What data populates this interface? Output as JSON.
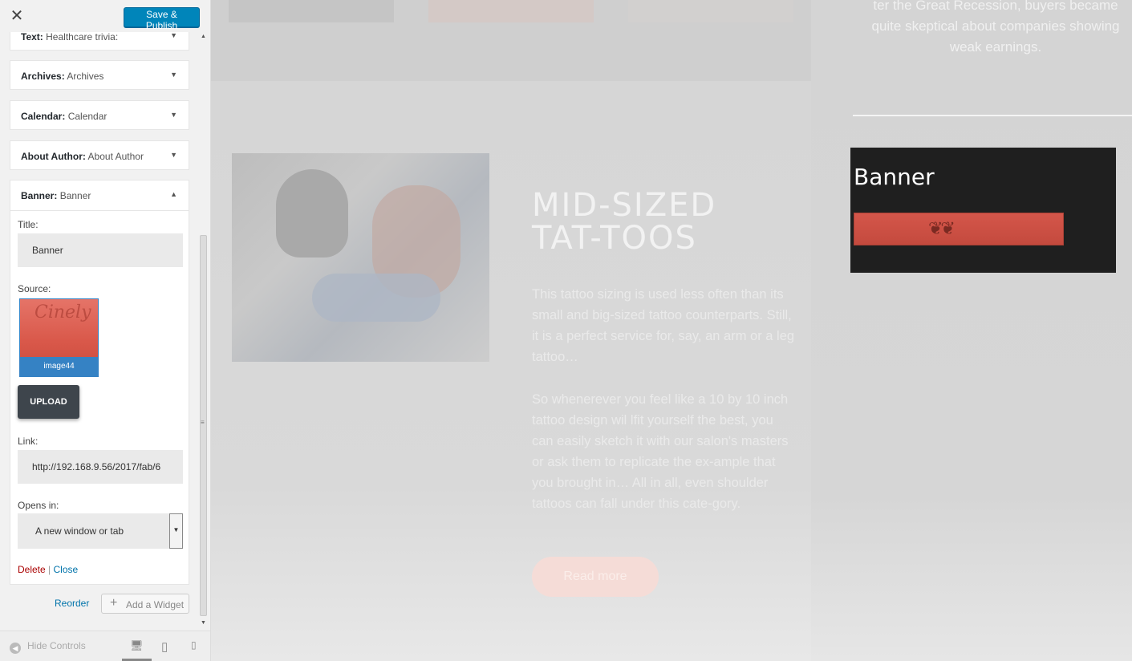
{
  "topbar": {
    "close_glyph": "✕",
    "save_label": "Save & Publish"
  },
  "widgets": [
    {
      "type": "Text",
      "name": "Healthcare trivia:",
      "caret": "▼"
    },
    {
      "type": "Archives",
      "name": "Archives",
      "caret": "▼"
    },
    {
      "type": "Calendar",
      "name": "Calendar",
      "caret": "▼"
    },
    {
      "type": "About Author",
      "name": "About Author",
      "caret": "▼"
    }
  ],
  "banner_widget": {
    "type": "Banner",
    "name": "Banner",
    "caret": "▲",
    "title_label": "Title:",
    "title_value": "Banner",
    "source_label": "Source:",
    "thumb_caption": "image44",
    "upload_label": "UPLOAD",
    "link_label": "Link:",
    "link_value": "http://192.168.9.56/2017/fab/6",
    "opens_label": "Opens in:",
    "opens_value": "A new window or tab",
    "delete_label": "Delete",
    "separator": "|",
    "close_label": "Close"
  },
  "actions": {
    "reorder_label": "Reorder",
    "add_widget_label": "Add a Widget",
    "add_widget_glyph": "+"
  },
  "footer": {
    "hide_controls_label": "Hide Controls",
    "hide_controls_glyph": "◀",
    "device_desktop_glyph": "🖥",
    "device_tablet_glyph": "▯",
    "device_mobile_glyph": "▯"
  },
  "scrollbar": {
    "up": "▲",
    "down": "▼",
    "grip": "≡"
  },
  "preview": {
    "article_title": "MID-SIZED TAT-TOOS",
    "paragraph1": "This tattoo sizing is used less often than its small and big-sized tattoo counterparts. Still, it is a perfect service for, say, an arm or a leg tattoo…",
    "paragraph2": "So whenerever you feel like a 10 by 10 inch tattoo design wil lfit yourself the best, you can easily sketch it with our salon's masters or ask them to replicate the ex-ample that you brought in… All in all, even shoulder tattoos can fall under this cate-gory.",
    "read_more": "Read more",
    "sidebar_text": "ter the Great Recession, buyers became quite skeptical about companies showing weak earnings.",
    "banner_title": "Banner",
    "banner_ornament": "❦❦"
  },
  "colors": {
    "primary_button": "#0085ba",
    "link": "#0073aa",
    "delete": "#aa0000",
    "banner_bg": "#1f1f1f",
    "banner_image": "#d4564a"
  }
}
